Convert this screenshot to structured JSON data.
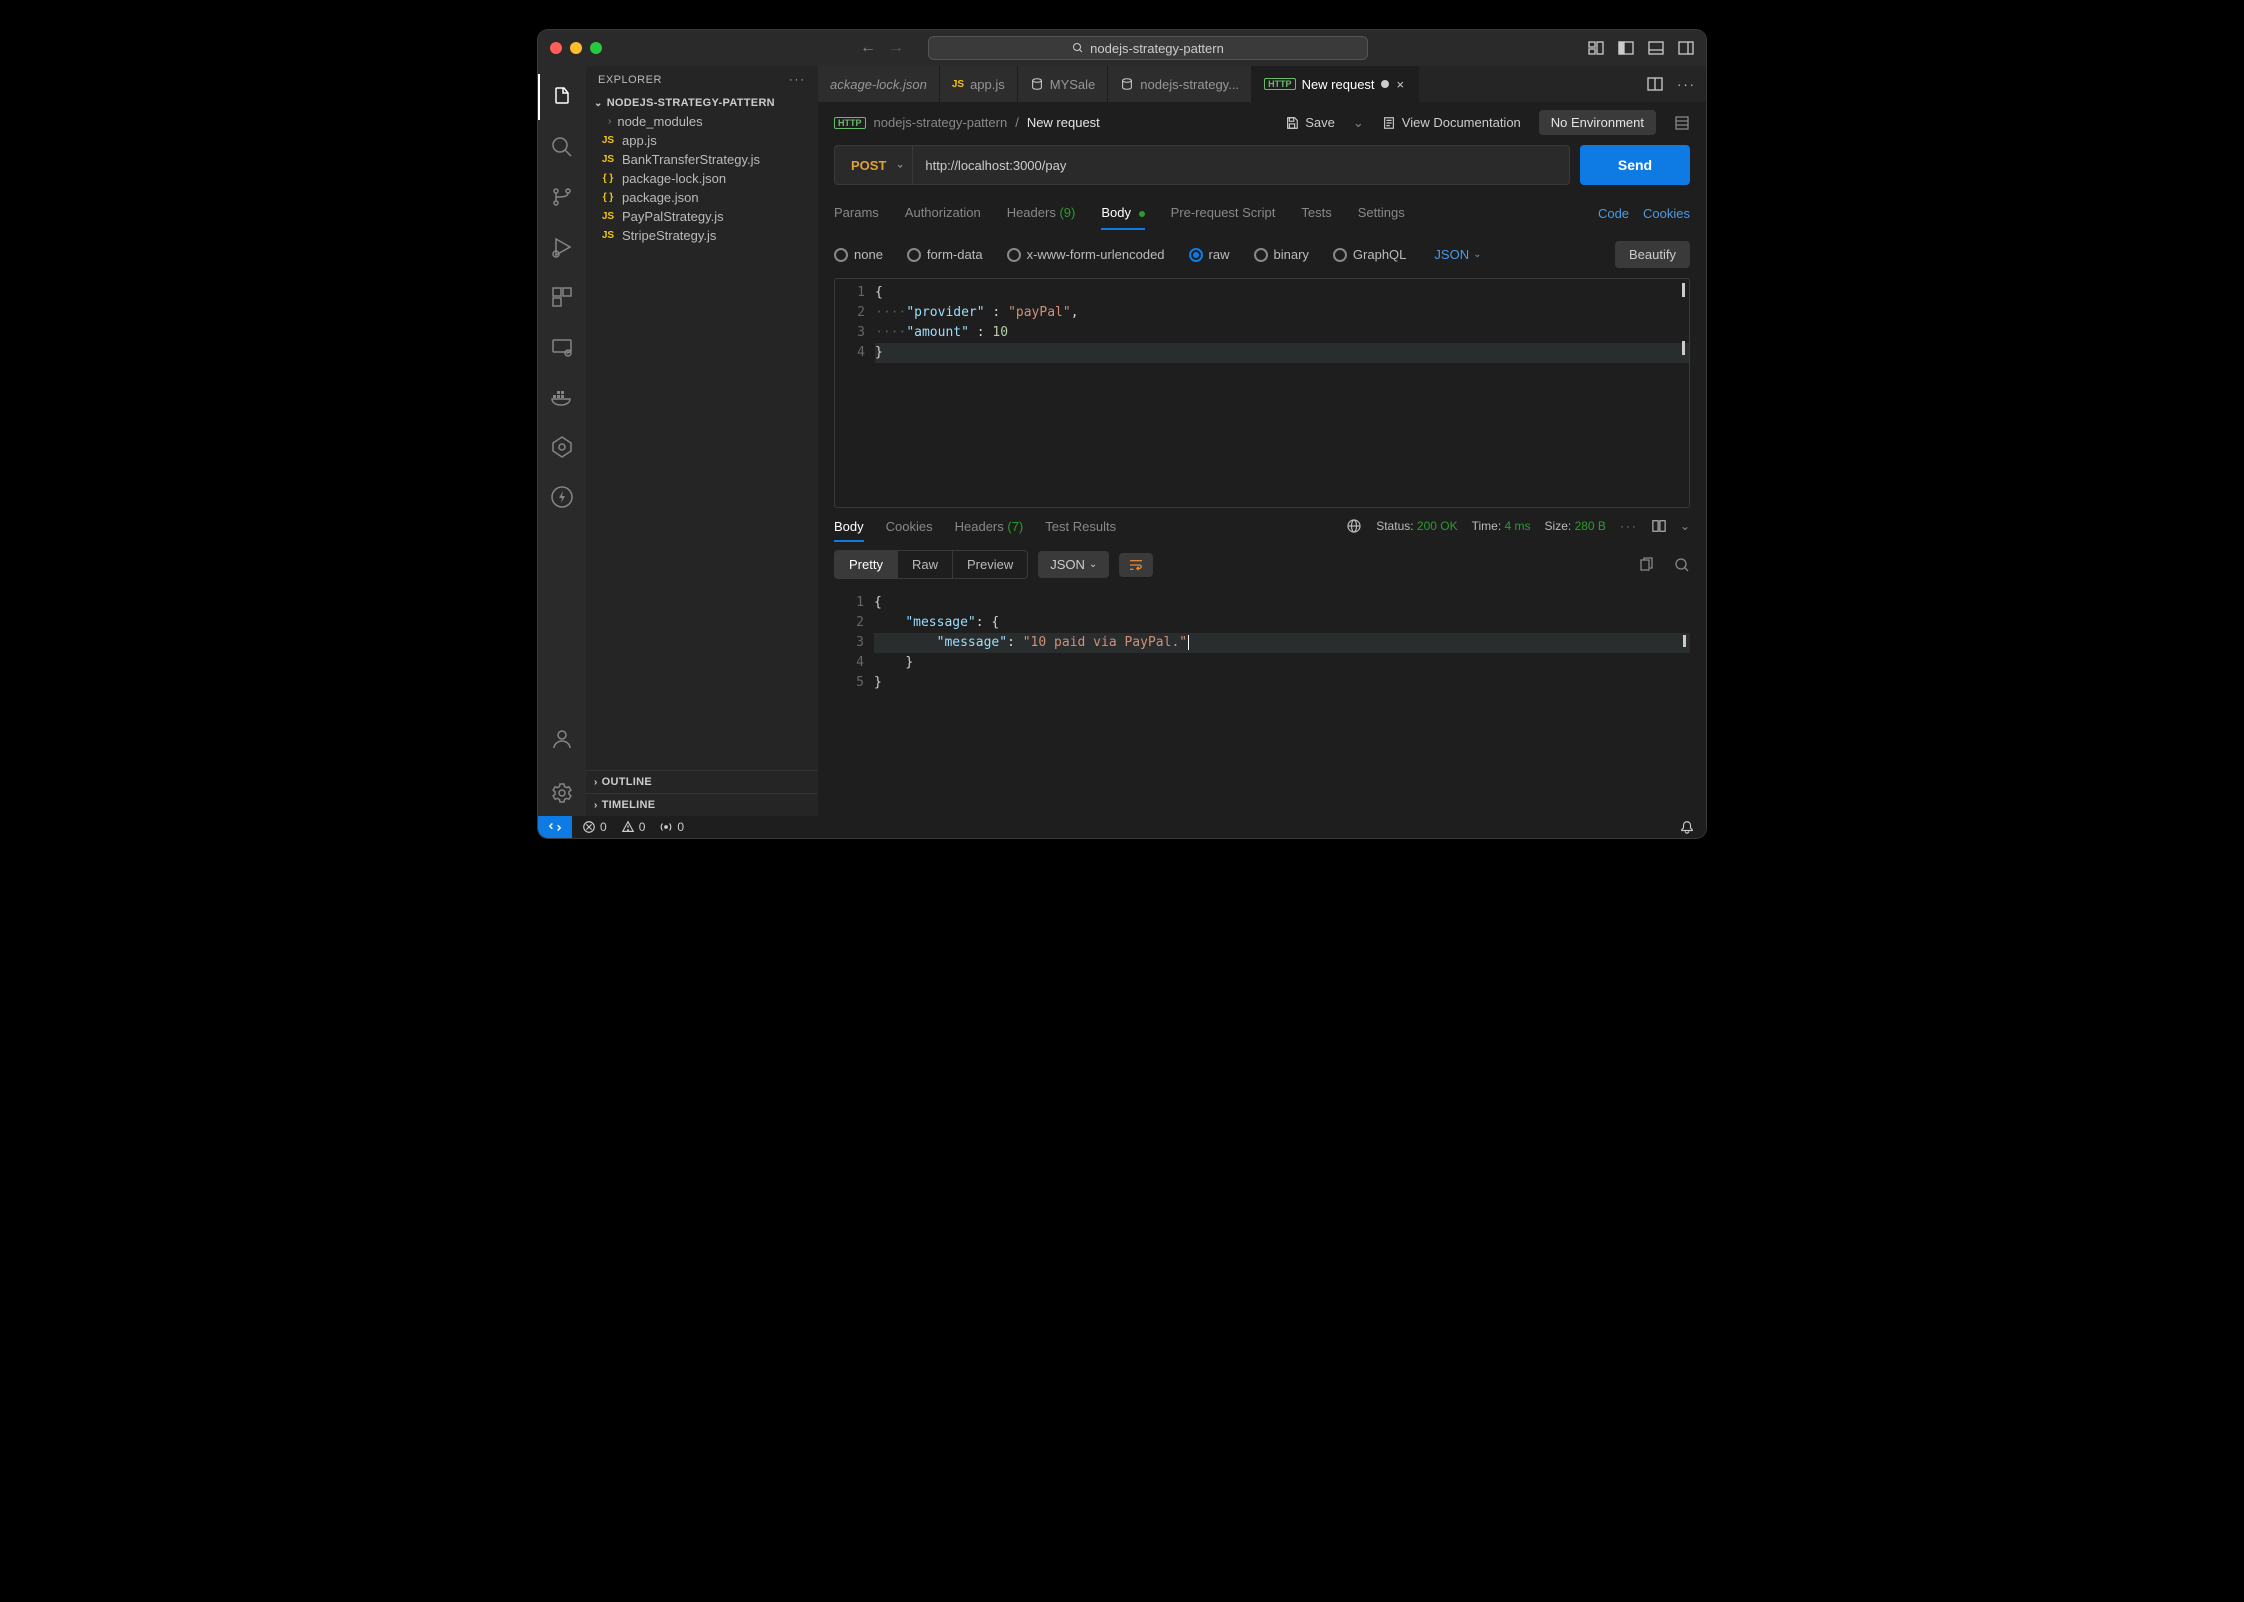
{
  "window": {
    "project_name": "nodejs-strategy-pattern"
  },
  "explorer": {
    "title": "EXPLORER",
    "root": "NODEJS-STRATEGY-PATTERN",
    "items": [
      {
        "label": "node_modules",
        "type": "folder"
      },
      {
        "label": "app.js",
        "type": "js"
      },
      {
        "label": "BankTransferStrategy.js",
        "type": "js"
      },
      {
        "label": "package-lock.json",
        "type": "json"
      },
      {
        "label": "package.json",
        "type": "json"
      },
      {
        "label": "PayPalStrategy.js",
        "type": "js"
      },
      {
        "label": "StripeStrategy.js",
        "type": "js"
      }
    ],
    "outline": "OUTLINE",
    "timeline": "TIMELINE"
  },
  "tabs": [
    {
      "label": "ackage-lock.json",
      "icon": "json",
      "italic": true
    },
    {
      "label": "app.js",
      "icon": "js"
    },
    {
      "label": "MYSale",
      "icon": "db"
    },
    {
      "label": "nodejs-strategy...",
      "icon": "db"
    },
    {
      "label": "New request",
      "icon": "http",
      "active": true,
      "dirty": true,
      "closable": true
    }
  ],
  "breadcrumb": {
    "collection": "nodejs-strategy-pattern",
    "current": "New request",
    "save": "Save",
    "view_docs": "View Documentation",
    "env": "No Environment"
  },
  "request": {
    "method": "POST",
    "url": "http://localhost:3000/pay",
    "send": "Send"
  },
  "req_tabs": {
    "params": "Params",
    "auth": "Authorization",
    "headers": "Headers",
    "headers_count": "(9)",
    "body": "Body",
    "prereq": "Pre-request Script",
    "tests": "Tests",
    "settings": "Settings",
    "code": "Code",
    "cookies": "Cookies"
  },
  "body_radio": {
    "none": "none",
    "form": "form-data",
    "xwww": "x-www-form-urlencoded",
    "raw": "raw",
    "binary": "binary",
    "graphql": "GraphQL",
    "json": "JSON",
    "beautify": "Beautify"
  },
  "request_body": {
    "l1": "{",
    "l2_indent": "····",
    "l2_key": "\"provider\"",
    "l2_sep": " : ",
    "l2_val": "\"payPal\"",
    "l2_comma": ",",
    "l3_indent": "····",
    "l3_key": "\"amount\"",
    "l3_sep": " : ",
    "l3_val": "10",
    "l4": "}"
  },
  "resp_tabs": {
    "body": "Body",
    "cookies": "Cookies",
    "headers": "Headers",
    "headers_count": "(7)",
    "test_results": "Test Results"
  },
  "resp_meta": {
    "status_label": "Status:",
    "status_value": "200 OK",
    "time_label": "Time:",
    "time_value": "4 ms",
    "size_label": "Size:",
    "size_value": "280 B"
  },
  "resp_view": {
    "pretty": "Pretty",
    "raw": "Raw",
    "preview": "Preview",
    "json": "JSON"
  },
  "response_body": {
    "l1": "{",
    "l2_key": "\"message\"",
    "l2_sep": ": ",
    "l2_open": "{",
    "l3_key": "\"message\"",
    "l3_sep": ": ",
    "l3_val": "\"10 paid via PayPal.\"",
    "l4": "}",
    "l5": "}"
  },
  "statusbar": {
    "errors": "0",
    "warnings": "0",
    "port": "0"
  }
}
